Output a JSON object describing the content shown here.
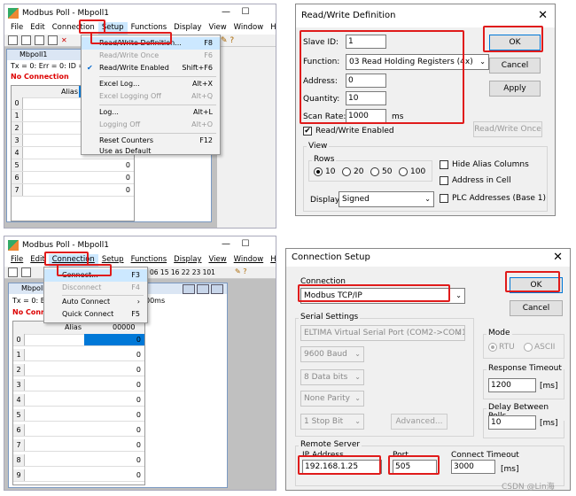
{
  "w1": {
    "title": "Modbus Poll - Mbpoll1",
    "menus": [
      "File",
      "Edit",
      "Connection",
      "Setup",
      "Functions",
      "Display",
      "View",
      "Window",
      "Help"
    ],
    "child_title": "Mbpoll1",
    "status": "Tx = 0: Err = 0: ID = 1",
    "no_conn": "No Connection",
    "col_alias": "Alias",
    "rows": [
      "0",
      "1",
      "2",
      "3",
      "4",
      "5",
      "6",
      "7"
    ],
    "zeros": "0",
    "setup_menu": [
      {
        "label": "Read/Write Definition...",
        "sc": "F8"
      },
      {
        "label": "Read/Write Once",
        "sc": "F6"
      },
      {
        "label": "Read/Write Enabled",
        "sc": "Shift+F6"
      },
      {
        "label": "Excel Log...",
        "sc": "Alt+X"
      },
      {
        "label": "Excel Logging Off",
        "sc": "Alt+Q"
      },
      {
        "label": "Log...",
        "sc": "Alt+L"
      },
      {
        "label": "Logging Off",
        "sc": "Alt+O"
      },
      {
        "label": "Reset Counters",
        "sc": "F12"
      },
      {
        "label": "Use as Default",
        "sc": ""
      }
    ],
    "check_mark": "✔"
  },
  "rwd": {
    "title": "Read/Write Definition",
    "slave_id_label": "Slave ID:",
    "slave_id": "1",
    "function_label": "Function:",
    "function": "03 Read Holding Registers (4x)",
    "address_label": "Address:",
    "address": "0",
    "quantity_label": "Quantity:",
    "quantity": "10",
    "scan_label": "Scan Rate:",
    "scan": "1000",
    "scan_unit": "ms",
    "rw_enabled": "Read/Write Enabled",
    "ok": "OK",
    "cancel": "Cancel",
    "apply": "Apply",
    "rw_once": "Read/Write Once",
    "view": "View",
    "rows": "Rows",
    "r10": "10",
    "r20": "20",
    "r50": "50",
    "r100": "100",
    "hide_alias": "Hide Alias Columns",
    "addr_in_cell": "Address in Cell",
    "plc_addr": "PLC Addresses (Base 1)",
    "display_label": "Display:",
    "display": "Signed"
  },
  "w2": {
    "title": "Modbus Poll - Mbpoll1",
    "menus": [
      "File",
      "Edit",
      "Connection",
      "Setup",
      "Functions",
      "Display",
      "View",
      "Window",
      "Help"
    ],
    "toolbar_codes": "06  15  16  22  23   101",
    "child_title": "Mbpoll1",
    "status_a": "Tx = 0: E",
    "status_b": "00ms",
    "no_conn": "No Conn",
    "col_alias": "Alias",
    "col_val": "00000",
    "rows": [
      "0",
      "1",
      "2",
      "3",
      "4",
      "5",
      "6",
      "7",
      "8",
      "9"
    ],
    "zeros": "0",
    "conn_menu": [
      {
        "label": "Connect...",
        "sc": "F3"
      },
      {
        "label": "Disconnect",
        "sc": "F4"
      },
      {
        "label": "Auto Connect",
        "sc": "›"
      },
      {
        "label": "Quick Connect",
        "sc": "F5"
      }
    ]
  },
  "cs": {
    "title": "Connection Setup",
    "connection": "Connection",
    "conn_type": "Modbus TCP/IP",
    "ok": "OK",
    "cancel": "Cancel",
    "serial": "Serial Settings",
    "port": "ELTIMA Virtual Serial Port (COM2->COM1)",
    "baud": "9600 Baud",
    "bits": "8 Data bits",
    "parity": "None Parity",
    "stop": "1 Stop Bit",
    "advanced": "Advanced...",
    "mode": "Mode",
    "rtu": "RTU",
    "ascii": "ASCII",
    "resp_timeout": "Response Timeout",
    "resp_val": "1200",
    "ms": "[ms]",
    "delay": "Delay Between Polls",
    "delay_val": "10",
    "remote": "Remote Server",
    "ip_label": "IP Address",
    "ip": "192.168.1.25",
    "port_label": "Port",
    "port_val": "505",
    "ct_label": "Connect Timeout",
    "ct_val": "3000",
    "ct_ms": "[ms]"
  },
  "watermark": "CSDN @Lin海"
}
